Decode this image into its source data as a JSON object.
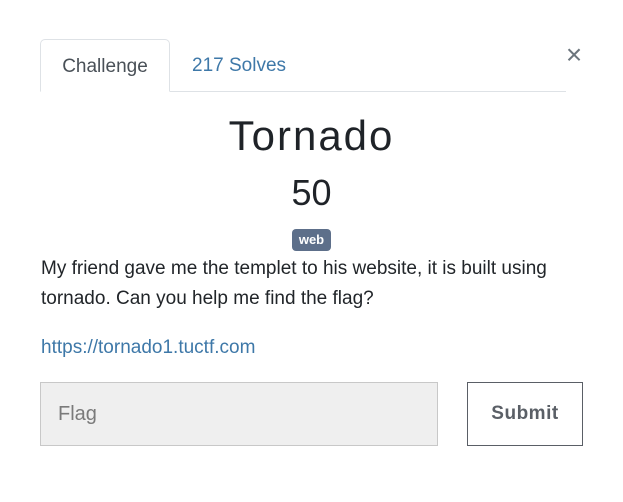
{
  "tabs": [
    {
      "label": "Challenge",
      "active": true
    },
    {
      "label": "217 Solves",
      "active": false
    }
  ],
  "close_label": "×",
  "challenge": {
    "name": "Tornado",
    "points": "50",
    "tag": "web",
    "description": "My friend gave me the templet to his website, it is built using tornado. Can you help me find the flag?",
    "link": "https://tornado1.tuctf.com"
  },
  "form": {
    "flag_placeholder": "Flag",
    "flag_value": "",
    "submit_label": "Submit"
  },
  "colors": {
    "link": "#3e78a8",
    "badge": "#5d6f8a",
    "input_background": "#efefef"
  },
  "icons": {
    "close": "close-icon"
  }
}
